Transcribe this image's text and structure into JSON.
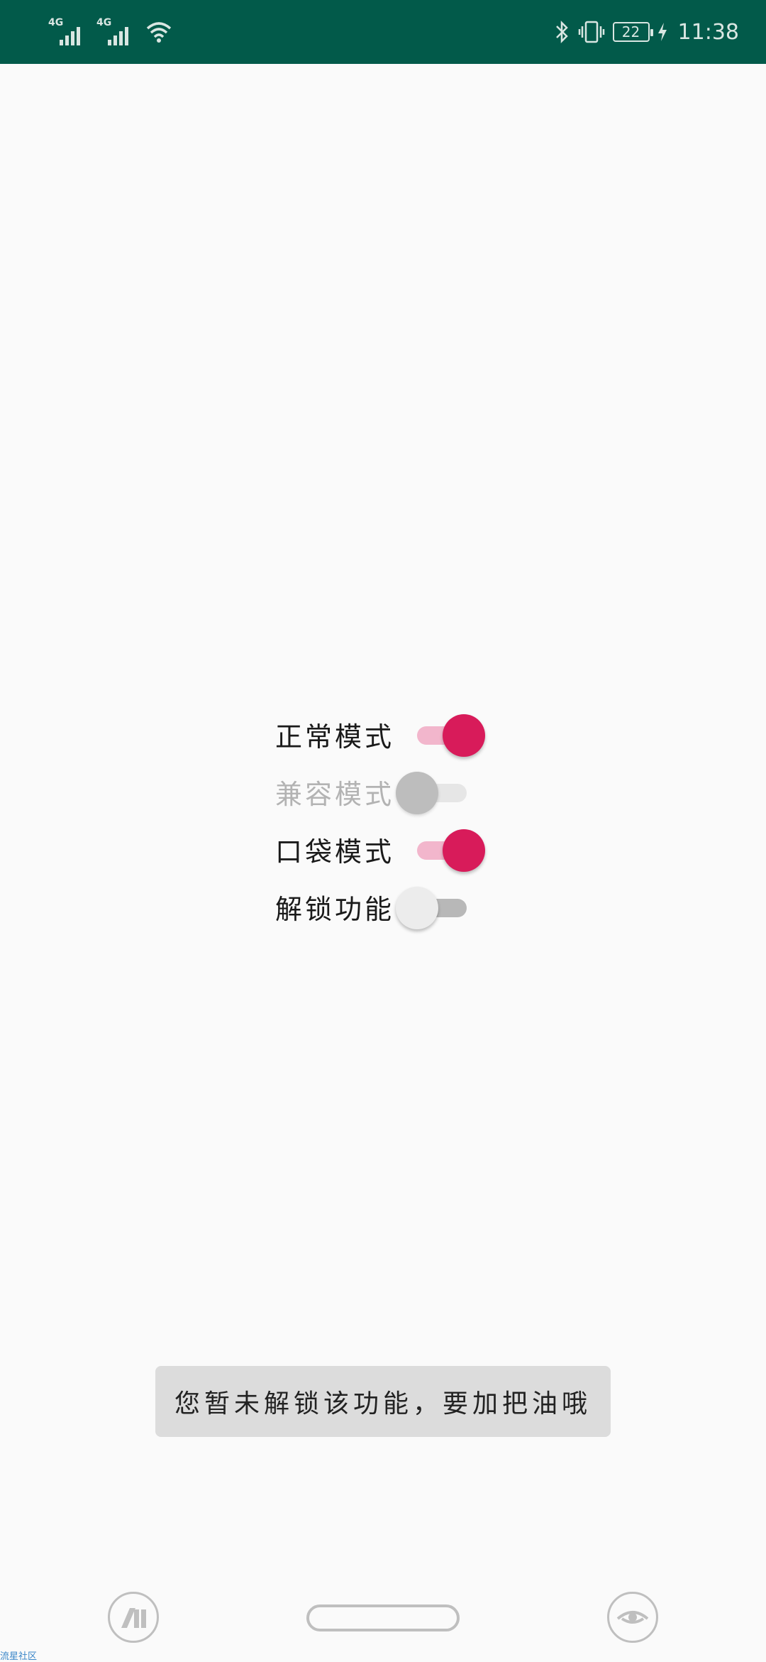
{
  "status_bar": {
    "signal1_label": "4G",
    "signal2_label": "4G",
    "battery_level": "22",
    "time": "11:38",
    "icons": [
      "signal-icon",
      "signal-icon",
      "wifi-icon",
      "bluetooth-icon",
      "vibrate-icon",
      "battery-icon",
      "charging-icon"
    ]
  },
  "toggles": [
    {
      "label": "正常模式",
      "state": "on",
      "enabled": true
    },
    {
      "label": "兼容模式",
      "state": "off",
      "enabled": false
    },
    {
      "label": "口袋模式",
      "state": "on",
      "enabled": true
    },
    {
      "label": "解锁功能",
      "state": "off",
      "enabled": true
    }
  ],
  "toast": {
    "message": "您暂未解锁该功能，要加把油哦"
  },
  "nav_bar": {
    "icons": [
      "app-logo-icon",
      "home-pill-icon",
      "eye-icon"
    ]
  },
  "watermark": "流星社区",
  "colors": {
    "status_bar_bg": "#025a4a",
    "accent": "#d81b5a",
    "accent_track": "#f2b6cc",
    "background": "#fafafa"
  }
}
